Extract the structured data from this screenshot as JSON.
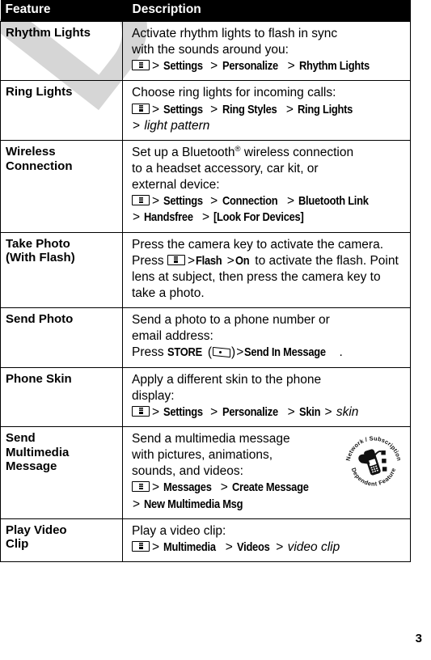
{
  "document": {
    "watermark_text": "DRAFT",
    "page_number": "3"
  },
  "table": {
    "headers": {
      "feature": "Feature",
      "description": "Description"
    },
    "rows": [
      {
        "feature": "Rhythm Lights",
        "desc_lines": [
          "Activate rhythm lights to flash in sync",
          "with the sounds around you:"
        ],
        "path_label": "Settings > Personalize > Rhythm Lights",
        "path_segments": [
          "Settings",
          "Personalize",
          "Rhythm Lights"
        ]
      },
      {
        "feature": "Ring Lights",
        "desc_lines": [
          "Choose ring lights for incoming calls:"
        ],
        "path_label": "Settings > Ring Styles > Ring Lights > light pattern",
        "path_segments": [
          "Settings",
          "Ring Styles",
          "Ring Lights"
        ],
        "path_italic_tail": "light pattern"
      },
      {
        "feature": "Wireless Connection",
        "desc_lines": [
          "Set up a Bluetooth® wireless connection",
          "to a headset accessory, car kit, or",
          "external device:"
        ],
        "bluetooth_word": "Bluetooth",
        "registered_mark": "®",
        "path_label": "Settings > Connection > Bluetooth Link > Handsfree > [Look For Devices]",
        "path_segments": [
          "Settings",
          "Connection",
          "Bluetooth Link"
        ],
        "path_segments_2": [
          "Handsfree",
          "[Look For Devices]"
        ]
      },
      {
        "feature": "Take Photo (With Flash)",
        "feature_line1": "Take Photo",
        "feature_line2": "(With Flash)",
        "desc_pre": "Press the camera key to activate the camera. Press",
        "desc_mid_segments": [
          "Flash",
          "On"
        ],
        "desc_post": "to activate the flash. Point lens at subject, then press the camera key to take a photo."
      },
      {
        "feature": "Send Photo",
        "desc_lines": [
          "Send a photo to a phone number or",
          "email address:"
        ],
        "press_word": "Press",
        "store_key": "STORE",
        "path_segments": [
          "Send In Message"
        ],
        "period": "."
      },
      {
        "feature": "Phone Skin",
        "desc_lines": [
          "Apply a different skin to the phone",
          "display:"
        ],
        "path_label": "Settings > Personalize > Skin > skin",
        "path_segments": [
          "Settings",
          "Personalize",
          "Skin"
        ],
        "path_italic_tail": "skin"
      },
      {
        "feature": "Send Multimedia Message",
        "feature_line1": "Send",
        "feature_line2": "Multimedia",
        "feature_line3": "Message",
        "desc_lines": [
          "Send a multimedia message",
          "with pictures, animations,",
          "sounds, and videos:"
        ],
        "path_label": "Messages > Create Message > New Multimedia Msg",
        "path_segments": [
          "Messages",
          "Create Message"
        ],
        "path_segments_2": [
          "New Multimedia Msg"
        ],
        "badge": {
          "name": "network-subscription-dependent-feature-badge",
          "top_text": "Network / Subscription",
          "bottom_text": "Dependent  Feature"
        }
      },
      {
        "feature": "Play Video Clip",
        "feature_line1": "Play Video",
        "feature_line2": "Clip",
        "desc_lines": [
          "Play a video clip:"
        ],
        "path_label": "Multimedia > Videos > video clip",
        "path_segments": [
          "Multimedia",
          "Videos"
        ],
        "path_italic_tail": "video clip"
      }
    ]
  },
  "icons": {
    "menu_key": "menu-key-icon",
    "soft_key": "soft-key-icon"
  },
  "colors": {
    "header_bg": "#000000",
    "header_text": "#ffffff",
    "body_text": "#000000",
    "border": "#000000",
    "watermark": "#d6d6d6",
    "page_bg": "#ffffff"
  }
}
